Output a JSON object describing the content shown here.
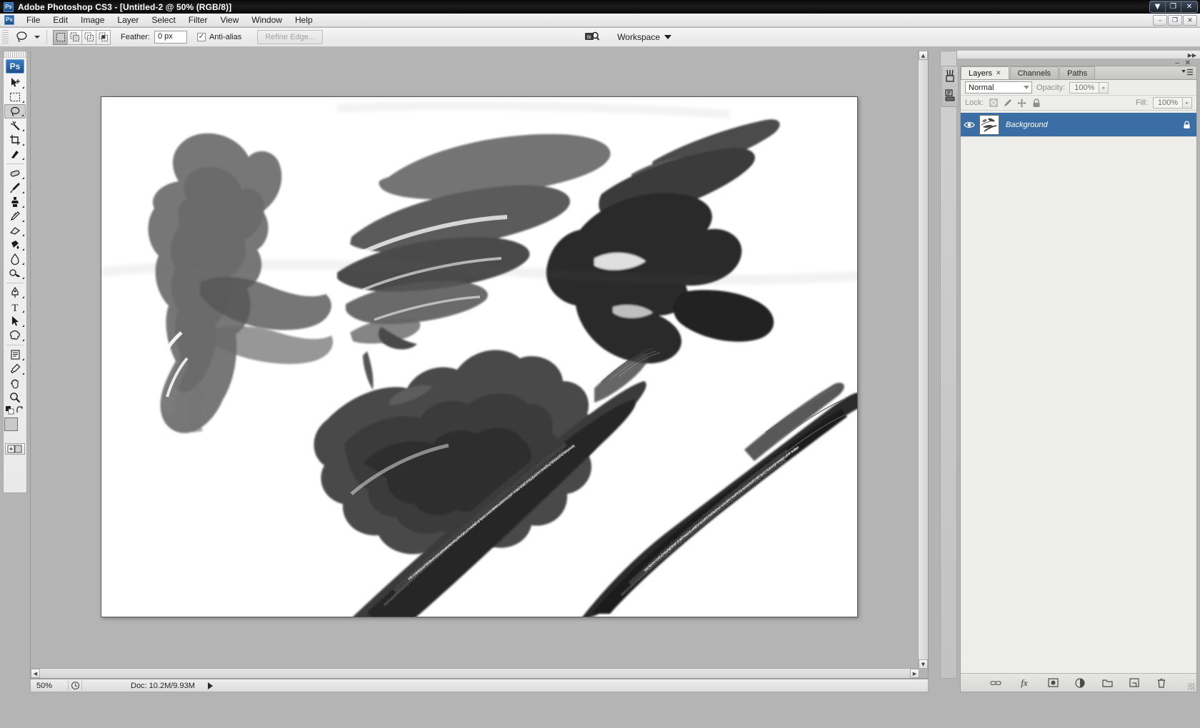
{
  "window": {
    "app_title": "Adobe Photoshop CS3 - [Untitled-2 @ 50% (RGB/8)]",
    "app_badge": "Ps",
    "controls": {
      "minimize": "▼",
      "restore": "❐",
      "close": "✕"
    },
    "doc_controls": {
      "minimize": "–",
      "restore": "❐",
      "close": "✕"
    }
  },
  "menu": {
    "items": [
      {
        "label": "File"
      },
      {
        "label": "Edit"
      },
      {
        "label": "Image"
      },
      {
        "label": "Layer"
      },
      {
        "label": "Select"
      },
      {
        "label": "Filter"
      },
      {
        "label": "View"
      },
      {
        "label": "Window"
      },
      {
        "label": "Help"
      }
    ]
  },
  "options_bar": {
    "active_tool": "lasso-tool",
    "selection_modes": [
      "new-selection",
      "add-to-selection",
      "subtract-from-selection",
      "intersect-with-selection"
    ],
    "feather_label": "Feather:",
    "feather_value": "0 px",
    "antialias_label": "Anti-alias",
    "antialias_checked": true,
    "refine_edge_label": "Refine Edge...",
    "refine_edge_enabled": false,
    "bridge_label": "Br",
    "workspace_label": "Workspace"
  },
  "toolbox": {
    "badge": "Ps",
    "tools": [
      {
        "name": "move-tool",
        "selected": false,
        "has_flyout": true
      },
      {
        "name": "rectangular-marquee-tool",
        "selected": false,
        "has_flyout": true
      },
      {
        "name": "lasso-tool",
        "selected": true,
        "has_flyout": true
      },
      {
        "name": "magic-wand-tool",
        "selected": false,
        "has_flyout": true
      },
      {
        "name": "crop-tool",
        "selected": false,
        "has_flyout": true
      },
      {
        "name": "slice-tool",
        "selected": false,
        "has_flyout": true
      },
      {
        "name": "healing-brush-tool",
        "selected": false,
        "has_flyout": true
      },
      {
        "name": "brush-tool",
        "selected": false,
        "has_flyout": true
      },
      {
        "name": "clone-stamp-tool",
        "selected": false,
        "has_flyout": true
      },
      {
        "name": "history-brush-tool",
        "selected": false,
        "has_flyout": true
      },
      {
        "name": "eraser-tool",
        "selected": false,
        "has_flyout": true
      },
      {
        "name": "gradient-tool",
        "selected": false,
        "has_flyout": true
      },
      {
        "name": "blur-tool",
        "selected": false,
        "has_flyout": true
      },
      {
        "name": "dodge-tool",
        "selected": false,
        "has_flyout": true
      },
      {
        "name": "pen-tool",
        "selected": false,
        "has_flyout": true
      },
      {
        "name": "type-tool",
        "selected": false,
        "has_flyout": true
      },
      {
        "name": "path-selection-tool",
        "selected": false,
        "has_flyout": true
      },
      {
        "name": "custom-shape-tool",
        "selected": false,
        "has_flyout": true
      },
      {
        "name": "notes-tool",
        "selected": false,
        "has_flyout": true
      },
      {
        "name": "eyedropper-tool",
        "selected": false,
        "has_flyout": true
      },
      {
        "name": "hand-tool",
        "selected": false,
        "has_flyout": false
      },
      {
        "name": "zoom-tool",
        "selected": false,
        "has_flyout": false
      }
    ],
    "foreground_color": "#c9c9c9",
    "background_color": "#3b3b3b"
  },
  "document": {
    "zoom_level": "50%",
    "doc_size": "Doc: 10.2M/9.93M",
    "canvas_background": "#ffffff"
  },
  "panel": {
    "tabs": [
      {
        "label": "Layers",
        "active": true,
        "closable": true
      },
      {
        "label": "Channels",
        "active": false,
        "closable": false
      },
      {
        "label": "Paths",
        "active": false,
        "closable": false
      }
    ],
    "blend_mode": "Normal",
    "opacity_label": "Opacity:",
    "opacity_value": "100%",
    "fill_label": "Fill:",
    "fill_value": "100%",
    "lock_label": "Lock:",
    "lock_icons": [
      "lock-transparent-pixels-icon",
      "lock-image-pixels-icon",
      "lock-position-icon",
      "lock-all-icon"
    ],
    "layers": [
      {
        "name": "Background",
        "visible": true,
        "locked": true,
        "selected": true
      }
    ],
    "footer_icons": [
      "link-layers-icon",
      "add-layer-style-icon",
      "add-layer-mask-icon",
      "new-adjustment-layer-icon",
      "new-group-icon",
      "new-layer-icon",
      "delete-layer-icon"
    ],
    "footer_fx_label": "fx"
  },
  "colors": {
    "titlebar": "#0d0d0d",
    "chrome": "#e8e8e8",
    "canvas_gray": "#b4b4b4",
    "layer_selected": "#3a6ea5",
    "panel_bg": "#edede9"
  }
}
